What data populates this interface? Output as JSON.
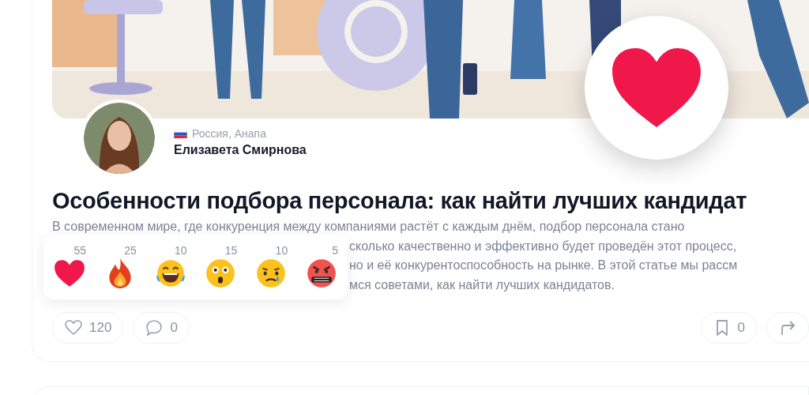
{
  "author": {
    "country": "Россия, Анапа",
    "name": "Елизавета Смирнова"
  },
  "title": "Особенности подбора персонала: как найти лучших кандидат",
  "description": [
    "В современном мире, где конкуренция между компаниями растёт с каждым днём, подбор персонала стано",
    "сколько качественно и эффективно будет проведён этот процесс,",
    "но и её конкурентоспособность на рынке. В этой статье мы рассм",
    "мся советами, как найти лучших кандидатов."
  ],
  "reactions": [
    {
      "kind": "heart",
      "count": "55"
    },
    {
      "kind": "fire",
      "count": "25"
    },
    {
      "kind": "laugh",
      "count": "10"
    },
    {
      "kind": "surprised",
      "count": "15"
    },
    {
      "kind": "sad",
      "count": "10"
    },
    {
      "kind": "angry",
      "count": "5"
    }
  ],
  "actions": [
    {
      "kind": "like",
      "count": "120"
    },
    {
      "kind": "comment",
      "count": "0"
    },
    {
      "kind": "bookmark",
      "count": "0"
    },
    {
      "kind": "share"
    }
  ]
}
